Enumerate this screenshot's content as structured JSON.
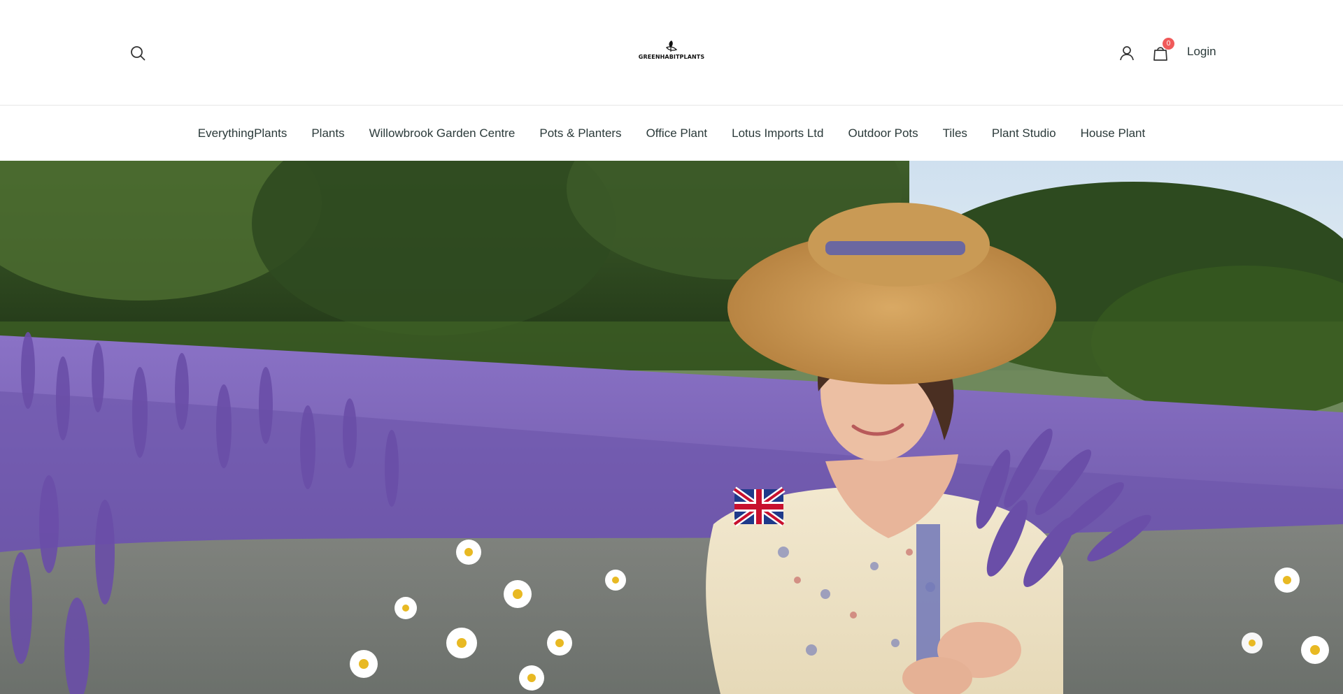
{
  "header": {
    "logo_text": "GREENHABITPLANTS",
    "login_label": "Login",
    "cart_count": "0"
  },
  "nav": {
    "items": [
      "EverythingPlants",
      "Plants",
      "Willowbrook Garden Centre",
      "Pots & Planters",
      "Office Plant",
      "Lotus Imports Ltd",
      "Outdoor Pots",
      "Tiles",
      "Plant Studio",
      "House Plant"
    ]
  },
  "colors": {
    "badge": "#f05a5a",
    "nav_text": "#2b3a3a",
    "lavender": "#7a5fb5"
  },
  "icons": {
    "search": "search-icon",
    "account": "user-icon",
    "cart": "shopping-bag-icon"
  }
}
